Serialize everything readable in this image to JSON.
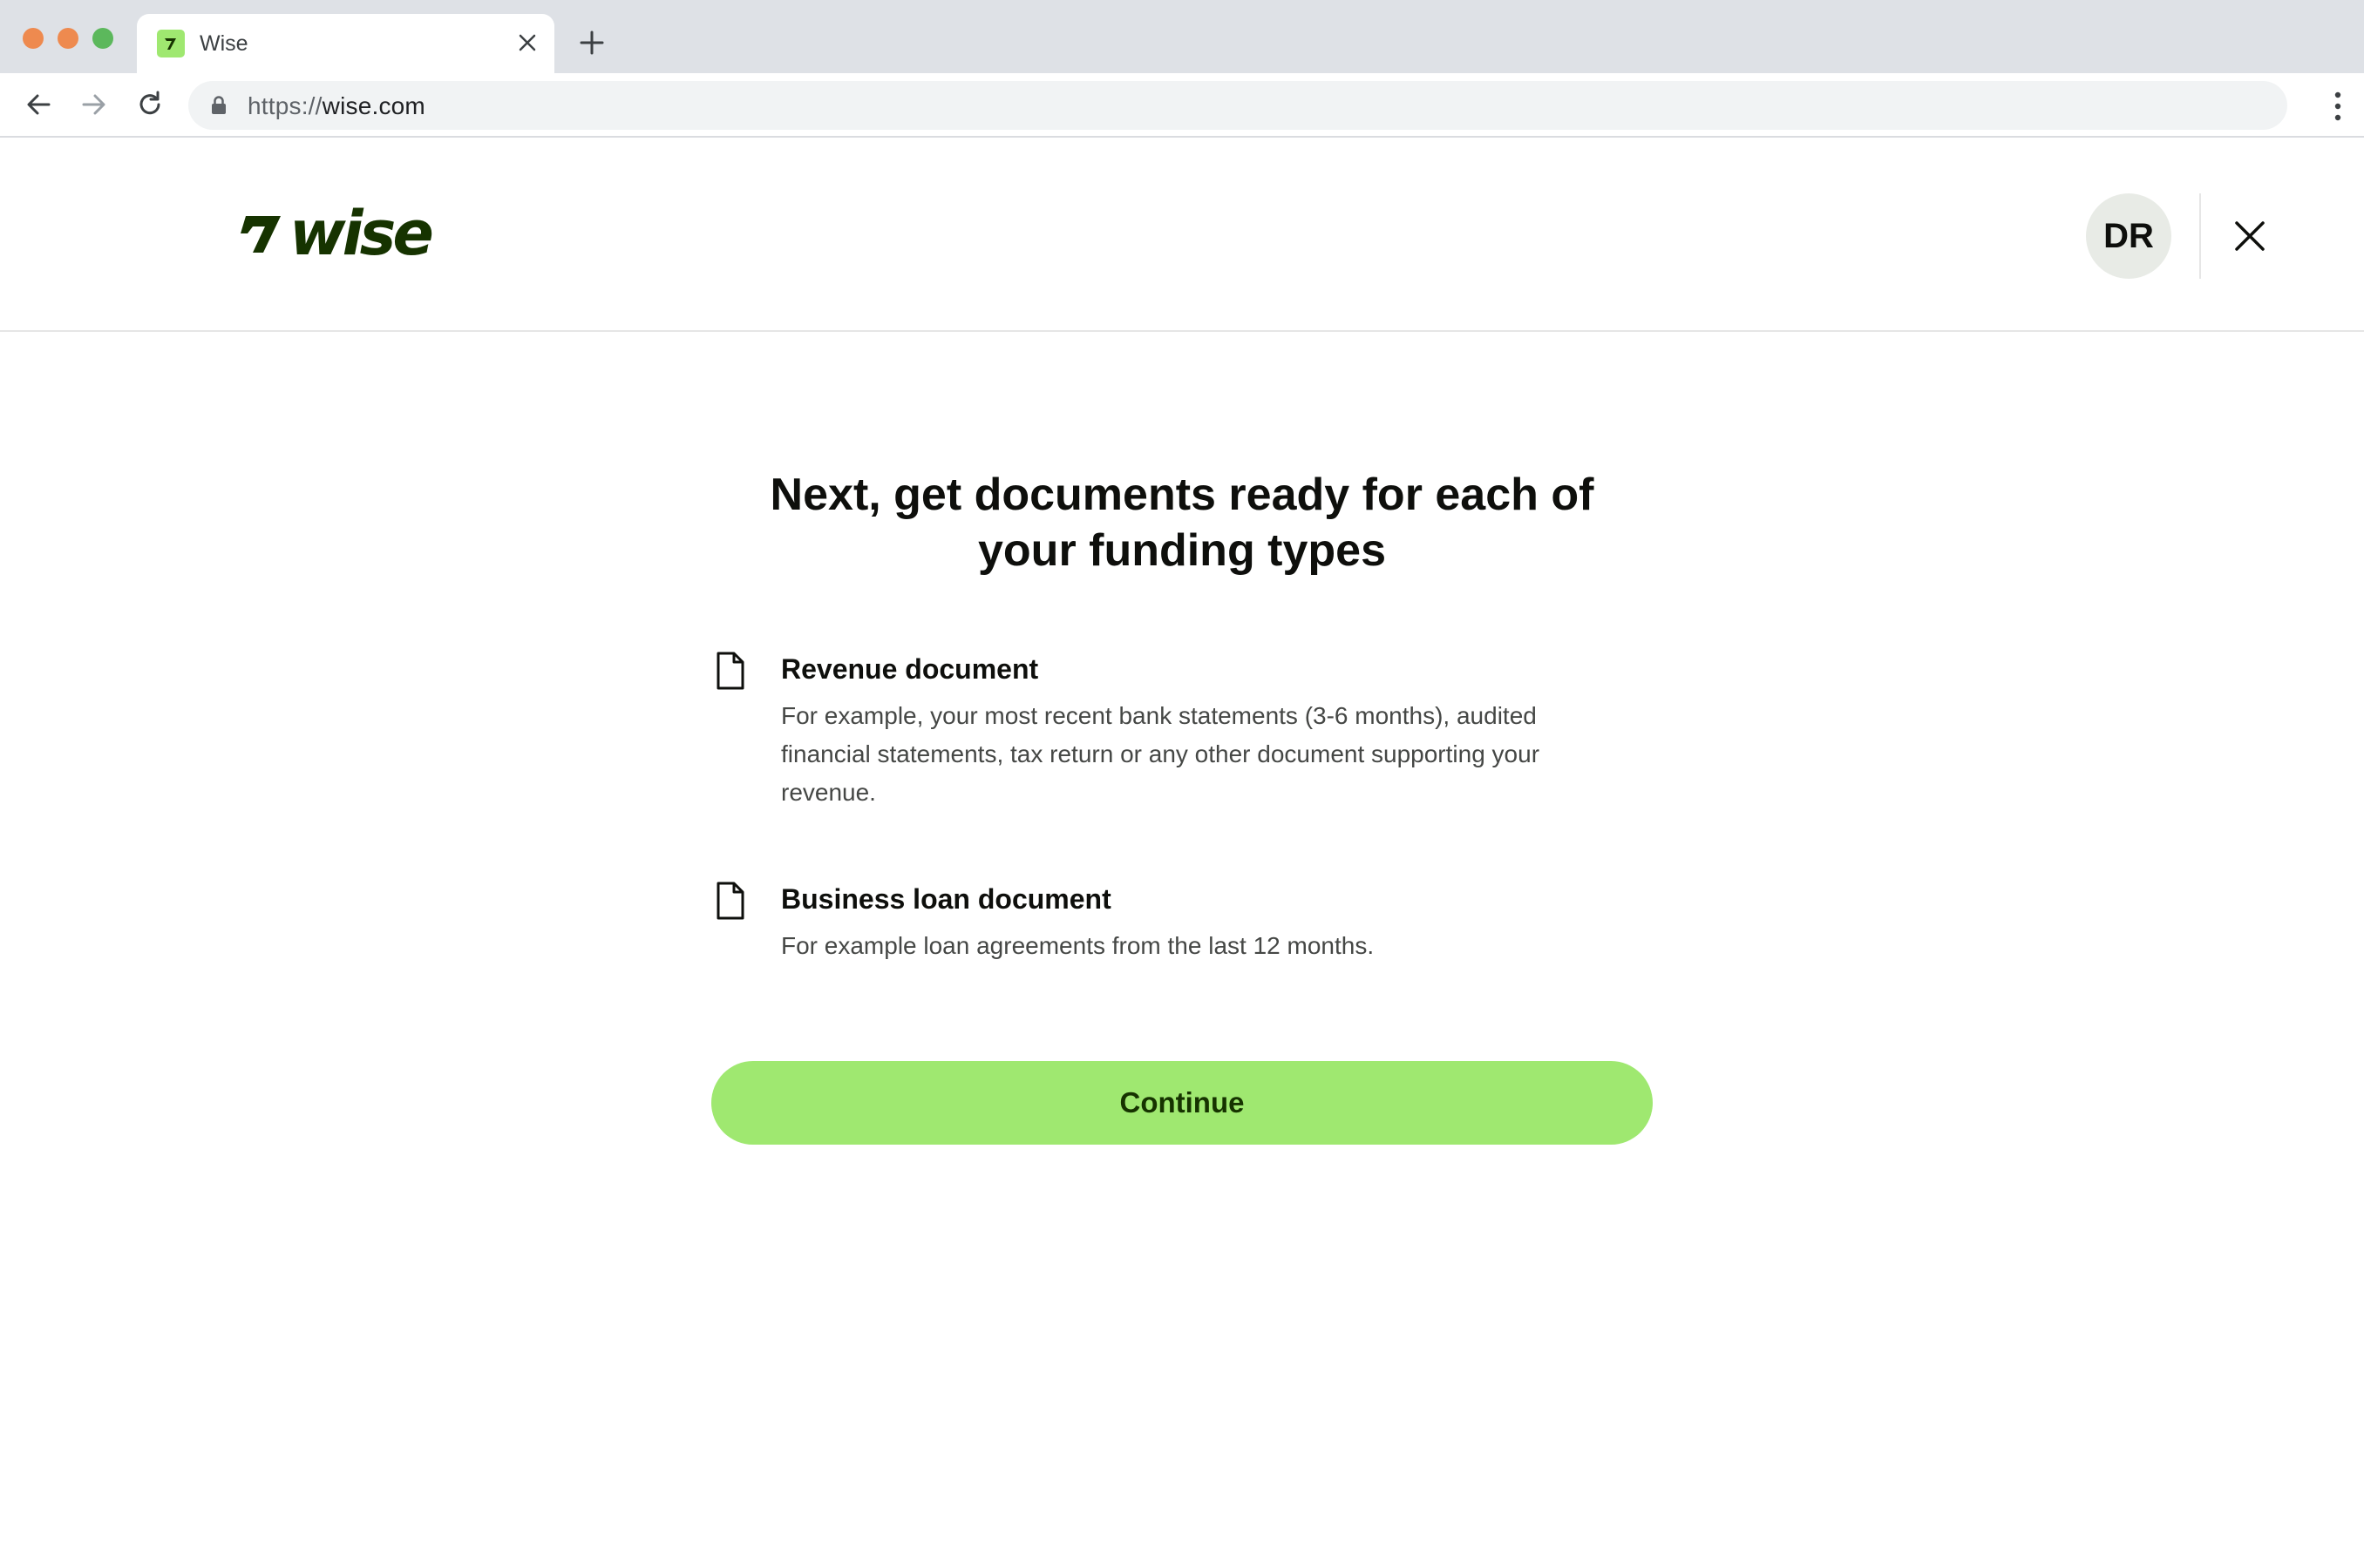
{
  "browser": {
    "tab_title": "Wise",
    "url_scheme": "https://",
    "url_host": "wise.com"
  },
  "header": {
    "logo_text": "wise",
    "avatar_initials": "DR"
  },
  "main": {
    "headline": "Next, get documents ready for each of your funding types",
    "documents": [
      {
        "title": "Revenue document",
        "description": "For example, your most recent bank statements (3-6 months), audited financial statements, tax return or any other document supporting your revenue."
      },
      {
        "title": "Business loan document",
        "description": "For example loan agreements from the last 12 months."
      }
    ],
    "continue_label": "Continue"
  },
  "colors": {
    "brand_green": "#9fe870",
    "brand_dark": "#163300"
  }
}
